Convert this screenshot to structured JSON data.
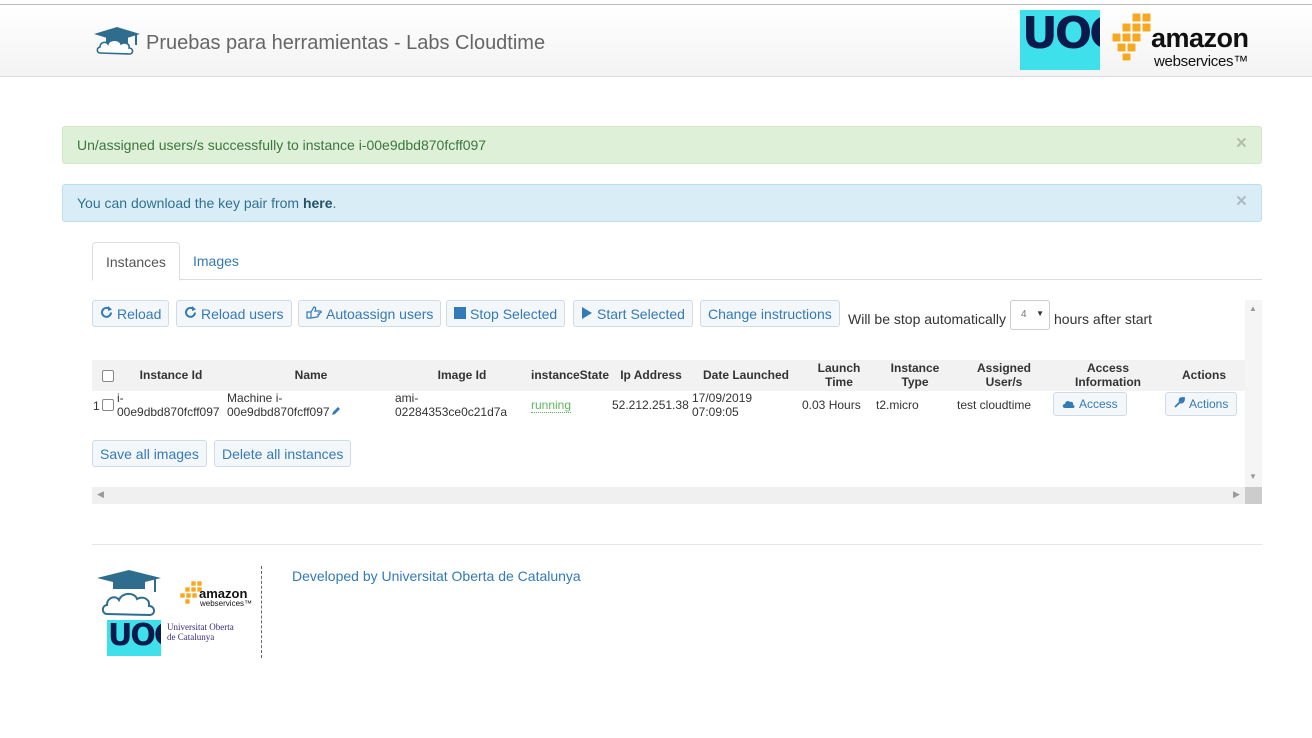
{
  "header": {
    "title": "Pruebas para herramientas - Labs Cloudtime",
    "uoc_logo_text": "UOC",
    "aws_logo_amazon": "amazon",
    "aws_logo_ws": "webservices™"
  },
  "alerts": {
    "success": {
      "text": "Un/assigned users/s successfully to instance i-00e9dbd870fcff097",
      "close": "×"
    },
    "info": {
      "text_before": "You can download the key pair from ",
      "link": "here",
      "text_after": ".",
      "close": "×"
    }
  },
  "tabs": [
    {
      "label": "Instances",
      "active": true
    },
    {
      "label": "Images",
      "active": false
    }
  ],
  "toolbar": {
    "reload": "Reload",
    "reload_users": "Reload users",
    "autoassign_users": "Autoassign users",
    "stop_selected": "Stop Selected",
    "start_selected": "Start Selected",
    "change_instructions": "Change instructions",
    "auto_stop_prefix": "Will be stop automatically",
    "auto_stop_value": "4",
    "auto_stop_suffix": "hours after start"
  },
  "table": {
    "headers": {
      "instance_id": "Instance Id",
      "name": "Name",
      "image_id": "Image Id",
      "state": "instanceState",
      "ip": "Ip Address",
      "date": "Date Launched",
      "launch_time_1": "Launch",
      "launch_time_2": "Time",
      "instance_type_1": "Instance",
      "instance_type_2": "Type",
      "assigned_1": "Assigned",
      "assigned_2": "User/s",
      "access_1": "Access",
      "access_2": "Information",
      "actions": "Actions"
    },
    "rows": [
      {
        "index": "1",
        "instance_id_1": "i-",
        "instance_id_2": "00e9dbd870fcff097",
        "name_1": "Machine i-",
        "name_2": "00e9dbd870fcff097",
        "image_id_1": "ami-",
        "image_id_2": "02284353ce0c21d7a",
        "state": "running",
        "ip": "52.212.251.38",
        "date_1": "17/09/2019",
        "date_2": "07:09:05",
        "launch_time": "0.03 Hours",
        "instance_type": "t2.micro",
        "assigned": "test cloudtime",
        "access_button": "Access",
        "actions_button": "Actions"
      }
    ]
  },
  "bottom_buttons": {
    "save_all_images": "Save all images",
    "delete_all_instances": "Delete all instances"
  },
  "footer": {
    "text": "Developed by Universitat Oberta de Catalunya",
    "uoc_text": "UOC",
    "uoc_name_1": "Universitat Oberta",
    "uoc_name_2": "de Catalunya",
    "aws_amazon": "amazon",
    "aws_ws": "webservices™"
  },
  "colors": {
    "link": "#337ab7",
    "success_bg": "#dff0d8",
    "info_bg": "#d9edf7",
    "running": "#5cb85c",
    "aws_orange": "#f7a823",
    "uoc_cyan": "#3ee0ec"
  }
}
